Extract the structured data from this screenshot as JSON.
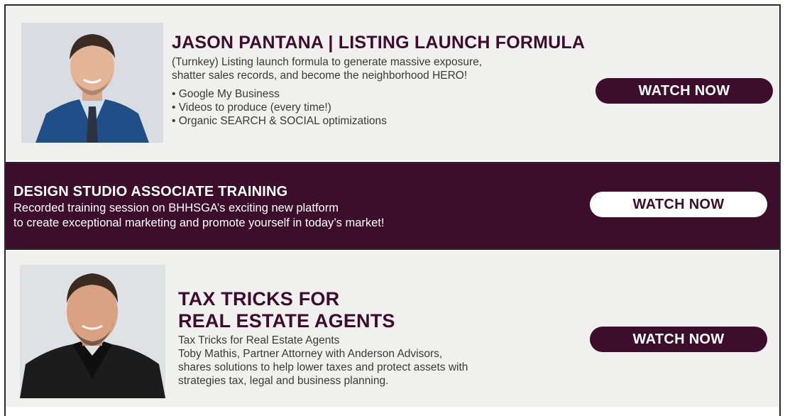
{
  "trainings": [
    {
      "title": "JASON PANTANA | LISTING LAUNCH FORMULA",
      "description_lines": [
        "(Turnkey) Listing launch formula to generate massive exposure,",
        "shatter sales records, and become the neighborhood HERO!"
      ],
      "bullets": [
        "Google My Business",
        "Videos to produce (every time!)",
        "Organic SEARCH & SOCIAL optimizations"
      ],
      "button_label": "WATCH NOW"
    },
    {
      "title": "DESIGN STUDIO ASSOCIATE TRAINING",
      "description_lines": [
        "Recorded training session on BHHSGA’s exciting new platform",
        "to create exceptional marketing and promote yourself in today’s market!"
      ],
      "button_label": "WATCH NOW"
    },
    {
      "title_lines": [
        "TAX TRICKS FOR",
        "REAL ESTATE AGENTS"
      ],
      "description_lines": [
        "Tax Tricks for Real Estate Agents",
        "Toby Mathis, Partner Attorney with Anderson Advisors,",
        "shares solutions to help lower taxes and protect assets with",
        "strategies tax, legal and business planning."
      ],
      "button_label": "WATCH NOW"
    }
  ],
  "colors": {
    "brand_purple": "#3d0d2c",
    "panel_light": "#f0f0ef",
    "text_gray": "#3a3a3a"
  }
}
